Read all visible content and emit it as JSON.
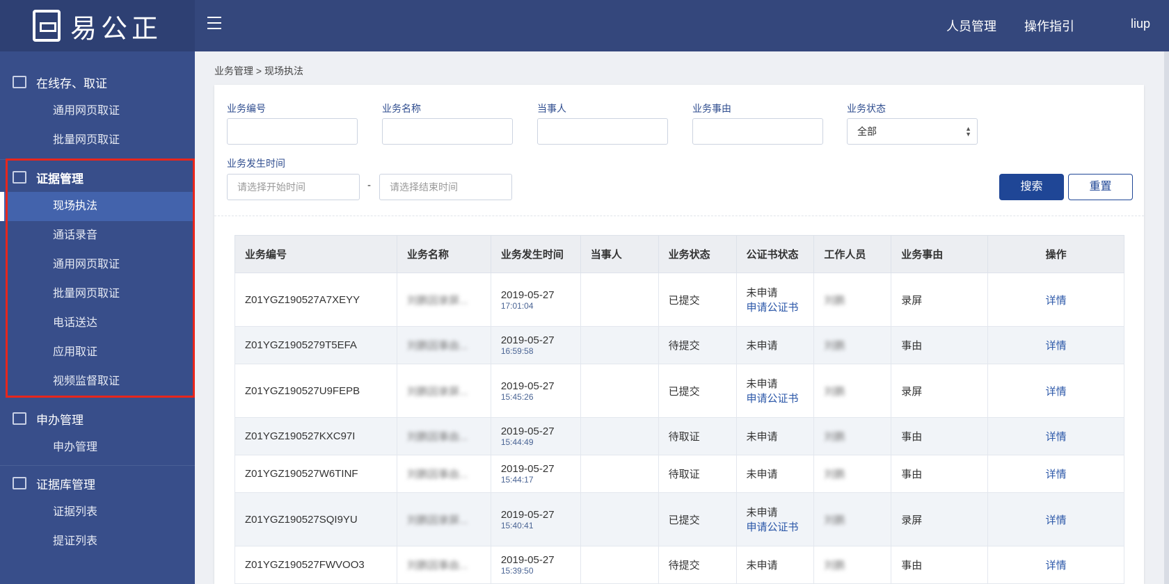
{
  "header": {
    "logo": "易公正",
    "nav": [
      "人员管理",
      "操作指引"
    ],
    "user": "liup"
  },
  "sidebar": {
    "group1": {
      "label": "在线存、取证",
      "items": [
        "通用网页取证",
        "批量网页取证"
      ]
    },
    "group2": {
      "label": "证据管理",
      "items": [
        "现场执法",
        "通话录音",
        "通用网页取证",
        "批量网页取证",
        "电话送达",
        "应用取证",
        "视频监督取证"
      ]
    },
    "group3": {
      "label": "申办管理",
      "items": [
        "申办管理"
      ]
    },
    "group4": {
      "label": "证据库管理",
      "items": [
        "证据列表",
        "提证列表"
      ]
    }
  },
  "breadcrumb": "业务管理 > 现场执法",
  "filters": {
    "code": "业务编号",
    "name": "业务名称",
    "party": "当事人",
    "reason": "业务事由",
    "status": "业务状态",
    "status_value": "全部",
    "time": "业务发生时间",
    "start_ph": "请选择开始时间",
    "end_ph": "请选择结束时间",
    "sep": "-",
    "search": "搜索",
    "reset": "重置"
  },
  "table": {
    "headers": [
      "业务编号",
      "业务名称",
      "业务发生时间",
      "当事人",
      "业务状态",
      "公证书状态",
      "工作人员",
      "业务事由",
      "操作"
    ],
    "rows": [
      {
        "id": "Z01YGZ190527A7XEYY",
        "name": "刘鹏因录屏...",
        "date": "2019-05-27",
        "time": "17:01:04",
        "party": "",
        "status": "已提交",
        "cert": "未申请",
        "apply": "申请公证书",
        "staff": "刘鹏",
        "reason": "录屏",
        "op": "详情"
      },
      {
        "id": "Z01YGZ1905279T5EFA",
        "name": "刘鹏因事由...",
        "date": "2019-05-27",
        "time": "16:59:58",
        "party": "",
        "status": "待提交",
        "cert": "未申请",
        "apply": "",
        "staff": "刘鹏",
        "reason": "事由",
        "op": "详情"
      },
      {
        "id": "Z01YGZ190527U9FEPB",
        "name": "刘鹏因录屏...",
        "date": "2019-05-27",
        "time": "15:45:26",
        "party": "",
        "status": "已提交",
        "cert": "未申请",
        "apply": "申请公证书",
        "staff": "刘鹏",
        "reason": "录屏",
        "op": "详情"
      },
      {
        "id": "Z01YGZ190527KXC97I",
        "name": "刘鹏因事由...",
        "date": "2019-05-27",
        "time": "15:44:49",
        "party": "",
        "status": "待取证",
        "cert": "未申请",
        "apply": "",
        "staff": "刘鹏",
        "reason": "事由",
        "op": "详情"
      },
      {
        "id": "Z01YGZ190527W6TINF",
        "name": "刘鹏因事由...",
        "date": "2019-05-27",
        "time": "15:44:17",
        "party": "",
        "status": "待取证",
        "cert": "未申请",
        "apply": "",
        "staff": "刘鹏",
        "reason": "事由",
        "op": "详情"
      },
      {
        "id": "Z01YGZ190527SQI9YU",
        "name": "刘鹏因录屏...",
        "date": "2019-05-27",
        "time": "15:40:41",
        "party": "",
        "status": "已提交",
        "cert": "未申请",
        "apply": "申请公证书",
        "staff": "刘鹏",
        "reason": "录屏",
        "op": "详情"
      },
      {
        "id": "Z01YGZ190527FWVOO3",
        "name": "刘鹏因事由...",
        "date": "2019-05-27",
        "time": "15:39:50",
        "party": "",
        "status": "待提交",
        "cert": "未申请",
        "apply": "",
        "staff": "刘鹏",
        "reason": "事由",
        "op": "详情"
      }
    ]
  },
  "colors": {
    "header": "#34477c",
    "sidebar": "#384e8a",
    "active": "#4363ac",
    "primary": "#1f4696",
    "highlight": "#e8261c"
  }
}
